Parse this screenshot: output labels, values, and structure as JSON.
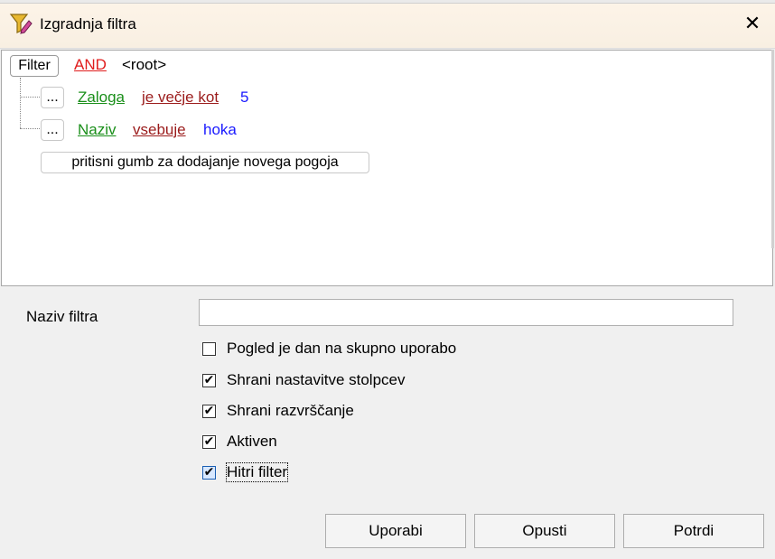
{
  "window": {
    "title": "Izgradnja filtra",
    "close_glyph": "✕",
    "icon": "funnel-edit-icon"
  },
  "tree": {
    "root_button": "Filter",
    "operator": "AND",
    "root_label": "<root>",
    "conditions": [
      {
        "menu": "...",
        "field": "Zaloga",
        "op": "je večje kot",
        "value": "5"
      },
      {
        "menu": "...",
        "field": "Naziv",
        "op": "vsebuje",
        "value": "hoka"
      }
    ],
    "add_hint": "pritisni gumb za dodajanje novega pogoja"
  },
  "form": {
    "name_label": "Naziv filtra",
    "name_value": "",
    "checkboxes": [
      {
        "label": "Pogled je dan na skupno uporabo",
        "checked": false
      },
      {
        "label": "Shrani nastavitve stolpcev",
        "checked": true
      },
      {
        "label": "Shrani razvrščanje",
        "checked": true
      },
      {
        "label": "Aktiven",
        "checked": true
      },
      {
        "label": "Hitri filter",
        "checked": true
      }
    ]
  },
  "buttons": {
    "apply": "Uporabi",
    "cancel": "Opusti",
    "ok": "Potrdi"
  },
  "colors": {
    "field": "#1a8f1a",
    "operator_logic": "#e01c1c",
    "operator": "#9b1c1c",
    "value": "#1a1aff"
  }
}
